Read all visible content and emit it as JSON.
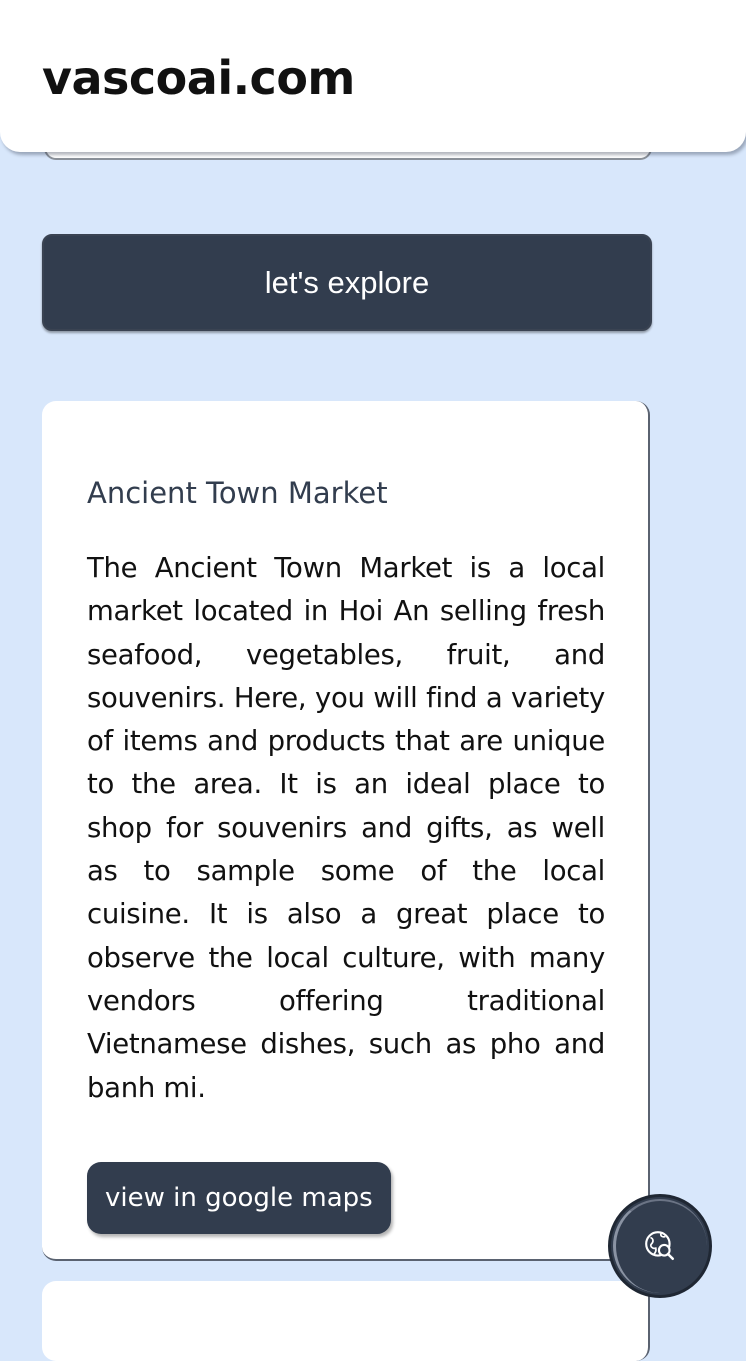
{
  "header": {
    "brand": "vascoai.com"
  },
  "explore_button": {
    "label": "let's explore"
  },
  "card": {
    "title": "Ancient Town Market",
    "description": "The Ancient Town Market is a local market located in Hoi An selling fresh seafood, vegetables, fruit, and souvenirs. Here, you will find a variety of items and products that are unique to the area. It is an ideal place to shop for souvenirs and gifts, as well as to sample some of the local cuisine. It is also a great place to observe the local culture, with many vendors offering traditional Vietnamese dishes, such as pho and banh mi.",
    "maps_button": "view in google maps"
  },
  "fab": {
    "icon": "globe-search-icon"
  },
  "colors": {
    "background": "#d8e7fb",
    "primary": "#323d4e",
    "surface": "#ffffff"
  }
}
